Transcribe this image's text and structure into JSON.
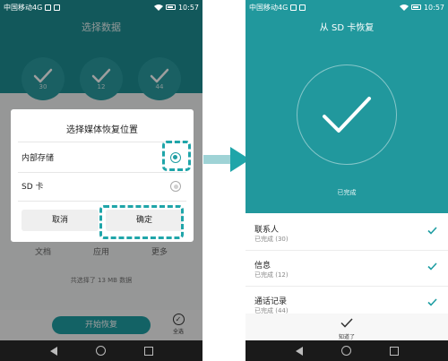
{
  "left": {
    "status": {
      "carrier": "中国移动4G",
      "time": "10:57"
    },
    "title": "选择数据",
    "circles": [
      {
        "count": "30"
      },
      {
        "count": "12"
      },
      {
        "count": "44"
      }
    ],
    "categories": [
      "文档",
      "应用",
      "更多"
    ],
    "summary": "共选择了 13 MB 数据",
    "start_button": "开始恢复",
    "select_all": "全选",
    "dialog": {
      "title": "选择媒体恢复位置",
      "options": [
        {
          "label": "内部存储",
          "selected": true
        },
        {
          "label": "SD 卡",
          "selected": false
        }
      ],
      "cancel": "取消",
      "confirm": "确定"
    }
  },
  "right": {
    "status": {
      "carrier": "中国移动4G",
      "time": "10:57"
    },
    "title": "从 SD 卡恢复",
    "completed": "已完成",
    "items": [
      {
        "name": "联系人",
        "status": "已完成 (30)"
      },
      {
        "name": "信息",
        "status": "已完成 (12)"
      },
      {
        "name": "通话记录",
        "status": "已完成 (44)"
      }
    ],
    "bottom_button": "知道了"
  },
  "colors": {
    "teal": "#1f9ea3",
    "highlight": "#1fa5a9"
  },
  "icons": [
    "check-icon",
    "back-icon",
    "home-icon",
    "recent-apps-icon",
    "wifi-icon",
    "battery-icon",
    "radio-icon",
    "arrow-right-icon"
  ]
}
